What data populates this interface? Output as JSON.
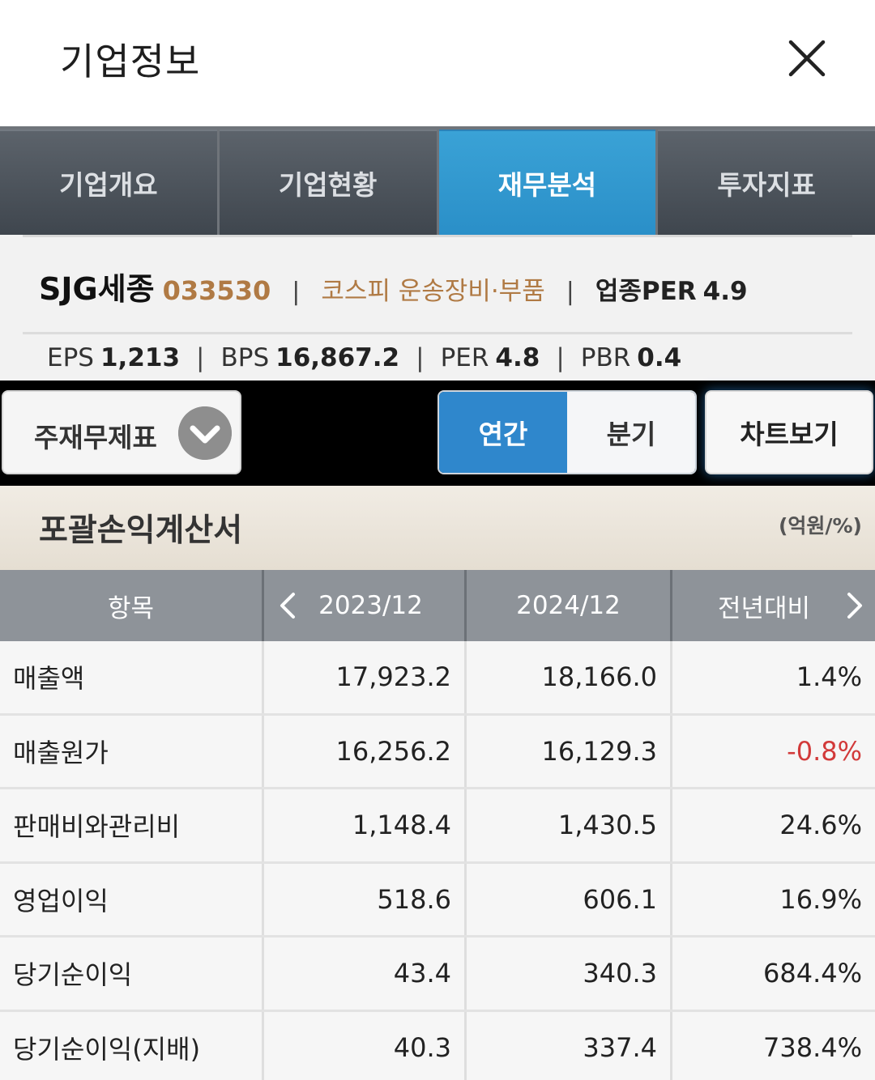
{
  "header": {
    "title": "기업정보"
  },
  "tabs": [
    {
      "label": "기업개요",
      "active": false
    },
    {
      "label": "기업현황",
      "active": false
    },
    {
      "label": "재무분석",
      "active": true
    },
    {
      "label": "투자지표",
      "active": false
    }
  ],
  "company": {
    "name": "SJG세종",
    "code": "033530",
    "market_sector": "코스피 운송장비·부품",
    "sector_per_label": "업종PER",
    "sector_per_value": "4.9",
    "separator": "|"
  },
  "metrics": [
    {
      "label": "EPS",
      "value": "1,213"
    },
    {
      "label": "BPS",
      "value": "16,867.2"
    },
    {
      "label": "PER",
      "value": "4.8"
    },
    {
      "label": "PBR",
      "value": "0.4"
    }
  ],
  "controls": {
    "statement_select": "주재무제표",
    "period_options": [
      "연간",
      "분기"
    ],
    "selected_period": "연간",
    "chart_button": "차트보기"
  },
  "statement": {
    "title": "포괄손익계산서",
    "unit": "(억원/%)"
  },
  "table": {
    "headers": [
      "항목",
      "2023/12",
      "2024/12",
      "전년대비"
    ],
    "rows": [
      {
        "item": "매출액",
        "y2023": "17,923.2",
        "y2024": "18,166.0",
        "yoy": "1.4%"
      },
      {
        "item": "매출원가",
        "y2023": "16,256.2",
        "y2024": "16,129.3",
        "yoy": "-0.8%"
      },
      {
        "item": "판매비와관리비",
        "y2023": "1,148.4",
        "y2024": "1,430.5",
        "yoy": "24.6%"
      },
      {
        "item": "영업이익",
        "y2023": "518.6",
        "y2024": "606.1",
        "yoy": "16.9%"
      },
      {
        "item": "당기순이익",
        "y2023": "43.4",
        "y2024": "340.3",
        "yoy": "684.4%"
      },
      {
        "item": "당기순이익(지배)",
        "y2023": "40.3",
        "y2024": "337.4",
        "yoy": "738.4%"
      }
    ]
  },
  "colors": {
    "accent_blue": "#2f87cc",
    "tab_active": "#3aa2d6",
    "code_brown": "#b07a44",
    "negative_red": "#d23a3a"
  },
  "icons": {
    "close": "close-icon",
    "dropdown": "chevron-down-icon",
    "prev": "chevron-left-icon",
    "next": "chevron-right-icon"
  }
}
